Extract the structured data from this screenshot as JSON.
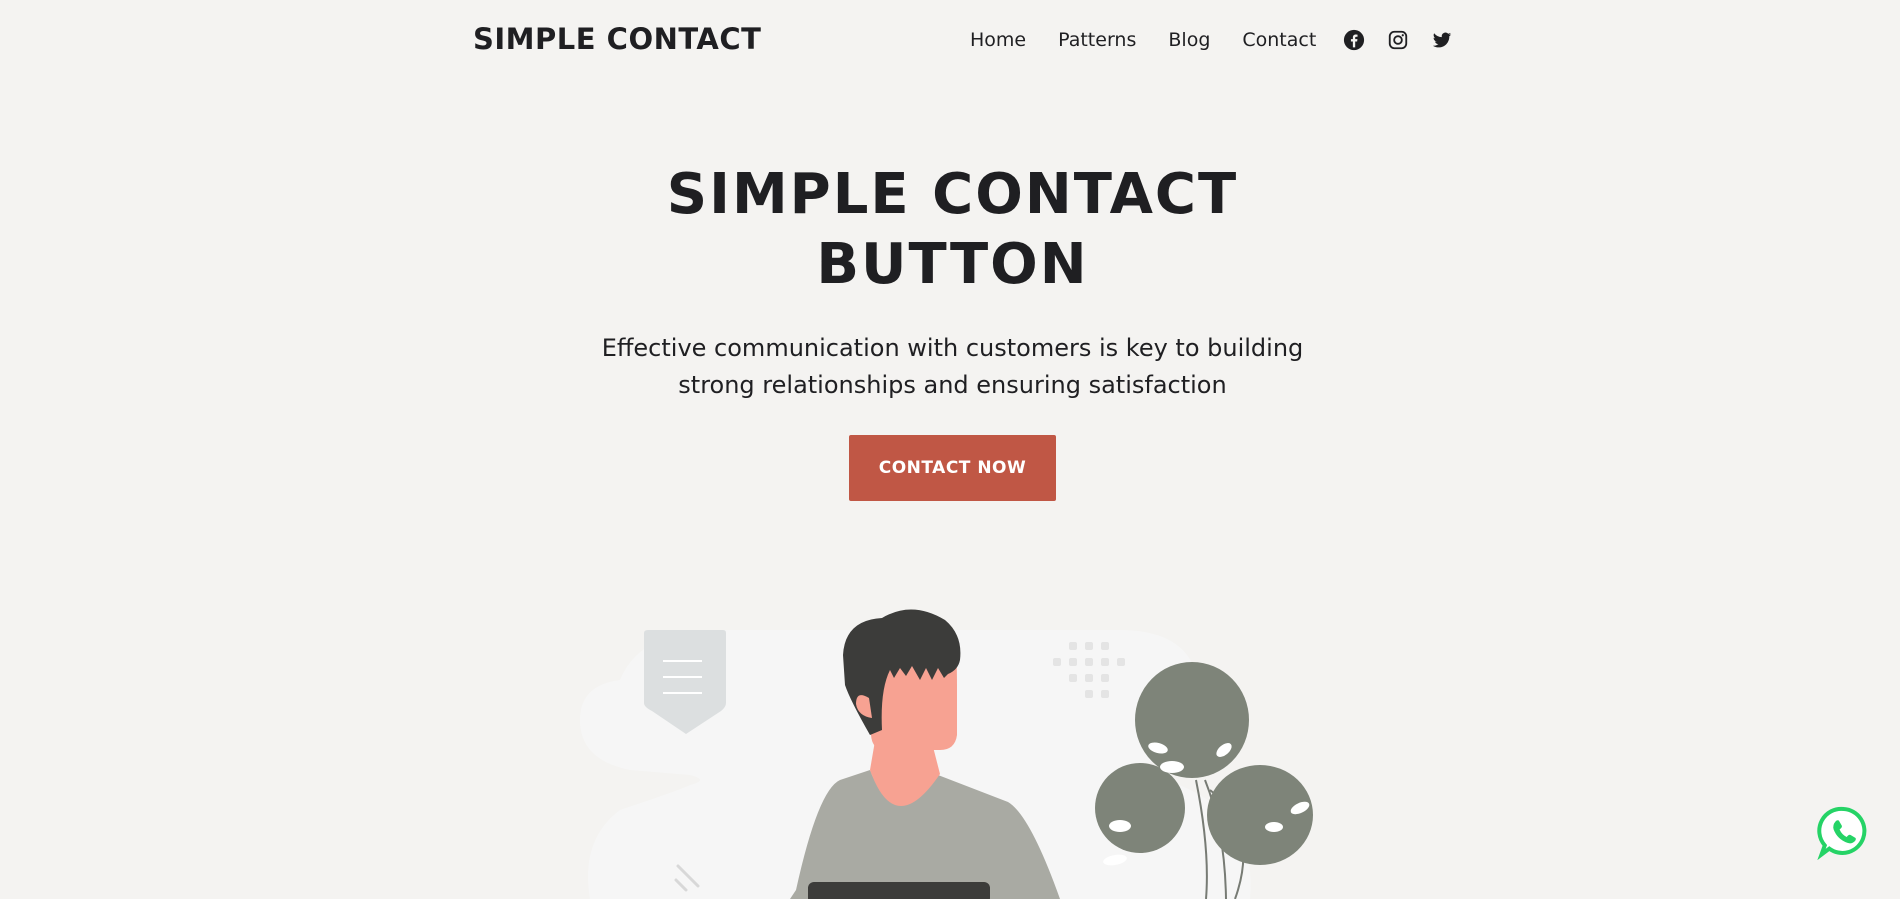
{
  "header": {
    "logo": "SIMPLE CONTACT",
    "nav": [
      {
        "label": "Home"
      },
      {
        "label": "Patterns"
      },
      {
        "label": "Blog"
      },
      {
        "label": "Contact"
      }
    ],
    "social_icons": [
      "facebook-icon",
      "instagram-icon",
      "twitter-icon"
    ]
  },
  "hero": {
    "title_line1": "SIMPLE CONTACT",
    "title_line2": "BUTTON",
    "subtitle_line1": "Effective communication with customers is key to building",
    "subtitle_line2": "strong relationships and ensuring satisfaction",
    "cta_label": "CONTACT NOW"
  },
  "colors": {
    "background": "#f4f3f1",
    "text": "#1f1f22",
    "cta": "#c05745",
    "whatsapp": "#25d366",
    "skin": "#f7a292",
    "shirt": "#a9aaa3",
    "hair": "#3c3c3a",
    "plant": "#7e8479"
  },
  "floating_button": {
    "icon": "whatsapp-icon"
  }
}
